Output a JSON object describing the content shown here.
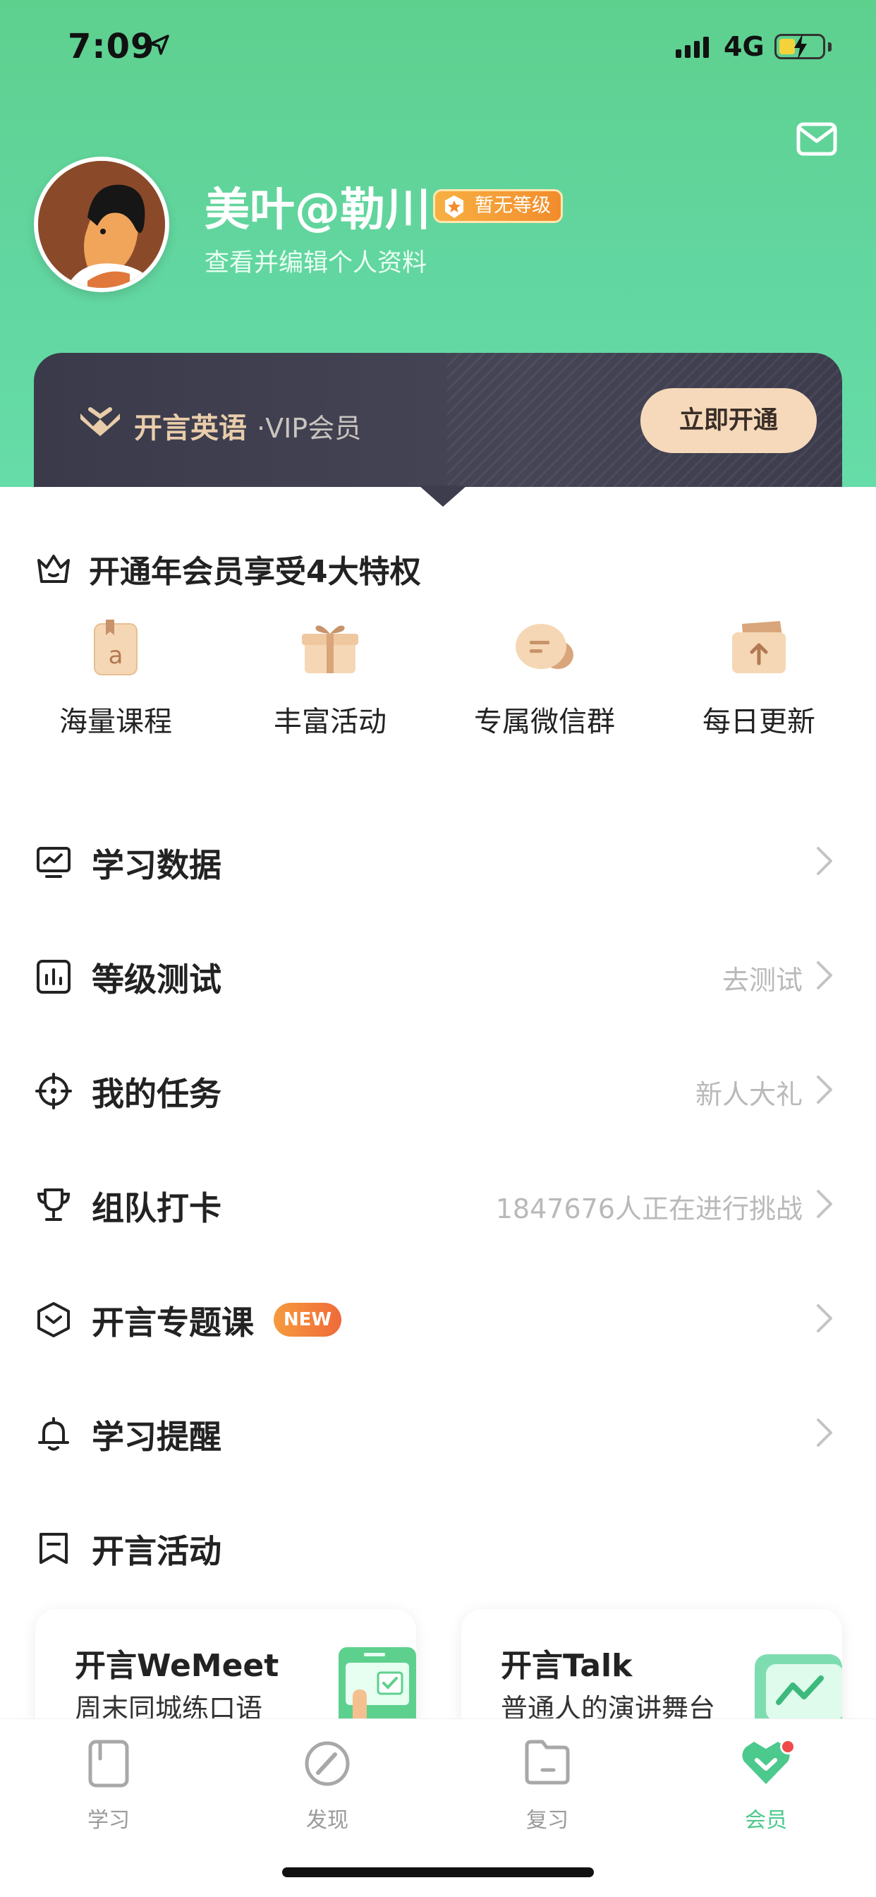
{
  "status_bar": {
    "time": "7:09",
    "network": "4G"
  },
  "profile": {
    "nickname": "美叶@勒川",
    "level_badge": "暂无等级",
    "edit_link": "查看并编辑个人资料"
  },
  "vip": {
    "brand": "开言英语",
    "subtitle": "·VIP会员",
    "open_button": "立即开通"
  },
  "privileges": {
    "title": "开通年会员享受4大特权",
    "items": [
      {
        "label": "海量课程",
        "icon": "course-book-icon"
      },
      {
        "label": "丰富活动",
        "icon": "gift-box-icon"
      },
      {
        "label": "专属微信群",
        "icon": "chat-bubble-icon"
      },
      {
        "label": "每日更新",
        "icon": "upload-folder-icon"
      }
    ]
  },
  "menu": [
    {
      "label": "学习数据",
      "extra": "",
      "icon": "study-data-icon"
    },
    {
      "label": "等级测试",
      "extra": "去测试",
      "icon": "level-test-icon"
    },
    {
      "label": "我的任务",
      "extra": "新人大礼",
      "icon": "task-target-icon"
    },
    {
      "label": "组队打卡",
      "extra": "1847676人正在进行挑战",
      "icon": "trophy-icon"
    },
    {
      "label": "开言专题课",
      "extra": "",
      "badge": "NEW",
      "icon": "topic-course-icon"
    },
    {
      "label": "学习提醒",
      "extra": "",
      "icon": "bell-icon"
    },
    {
      "label": "开言活动",
      "extra": "",
      "icon": "activity-bookmark-icon"
    }
  ],
  "cards": [
    {
      "title": "开言WeMeet",
      "subtitle": "周末同城练口语"
    },
    {
      "title": "开言Talk",
      "subtitle": "普通人的演讲舞台"
    }
  ],
  "tabs": [
    {
      "label": "学习",
      "icon": "study-book-icon"
    },
    {
      "label": "发现",
      "icon": "compass-icon"
    },
    {
      "label": "复习",
      "icon": "review-folder-icon"
    },
    {
      "label": "会员",
      "icon": "member-heart-icon",
      "active": true
    }
  ],
  "colors": {
    "brand_green": "#5ED08E",
    "vip_dark": "#3A3A4A",
    "vip_gold": "#F6D9BA",
    "badge_orange": "#F28C2C",
    "active_tab": "#4CC98C"
  }
}
